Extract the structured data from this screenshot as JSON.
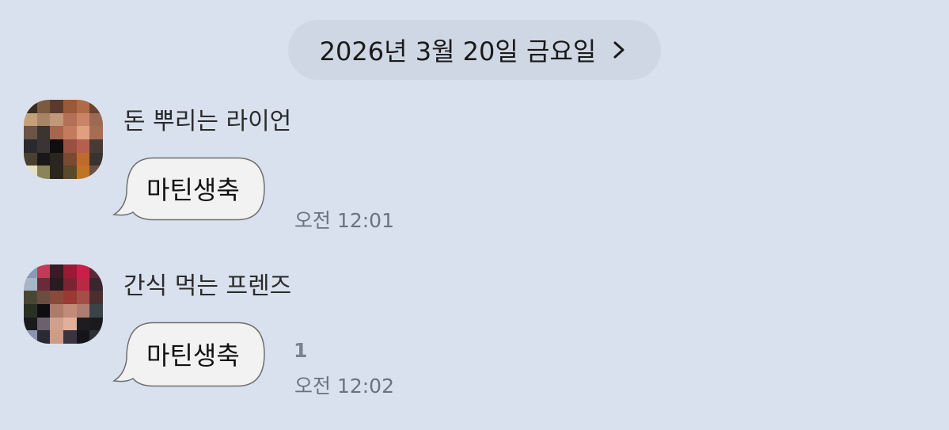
{
  "date_header": {
    "label": "2026년 3월 20일 금요일",
    "chevron_icon": "chevron-right-icon"
  },
  "messages": [
    {
      "sender": "돈 뿌리는 라이언",
      "text": "마틴생축",
      "time": "오전 12:01",
      "unread": ""
    },
    {
      "sender": "간식 먹는 프렌즈",
      "text": "마틴생축",
      "time": "오전 12:02",
      "unread": "1"
    }
  ],
  "colors": {
    "background": "#d9e1ee",
    "date_pill": "#cfd7e4",
    "bubble": "#f2f2f2",
    "time_text": "#6b7280"
  }
}
